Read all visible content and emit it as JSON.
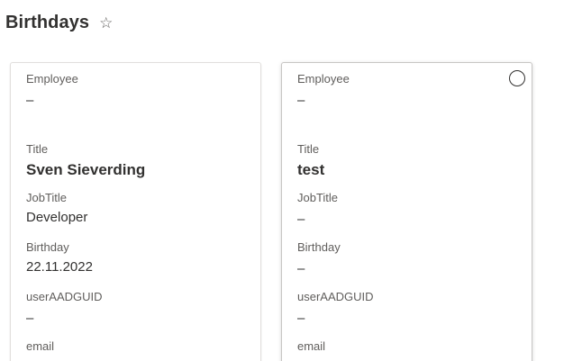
{
  "header": {
    "title": "Birthdays",
    "favorite_icon": "☆"
  },
  "cards": [
    {
      "employee_label": "Employee",
      "employee_value": "–",
      "title_label": "Title",
      "title_value": "Sven Sieverding",
      "jobtitle_label": "JobTitle",
      "jobtitle_value": "Developer",
      "birthday_label": "Birthday",
      "birthday_value": "22.11.2022",
      "guid_label": "userAADGUID",
      "guid_value": "–",
      "email_label": "email"
    },
    {
      "employee_label": "Employee",
      "employee_value": "–",
      "title_label": "Title",
      "title_value": "test",
      "jobtitle_label": "JobTitle",
      "jobtitle_value": "–",
      "birthday_label": "Birthday",
      "birthday_value": "–",
      "guid_label": "userAADGUID",
      "guid_value": "–",
      "email_label": "email"
    }
  ]
}
